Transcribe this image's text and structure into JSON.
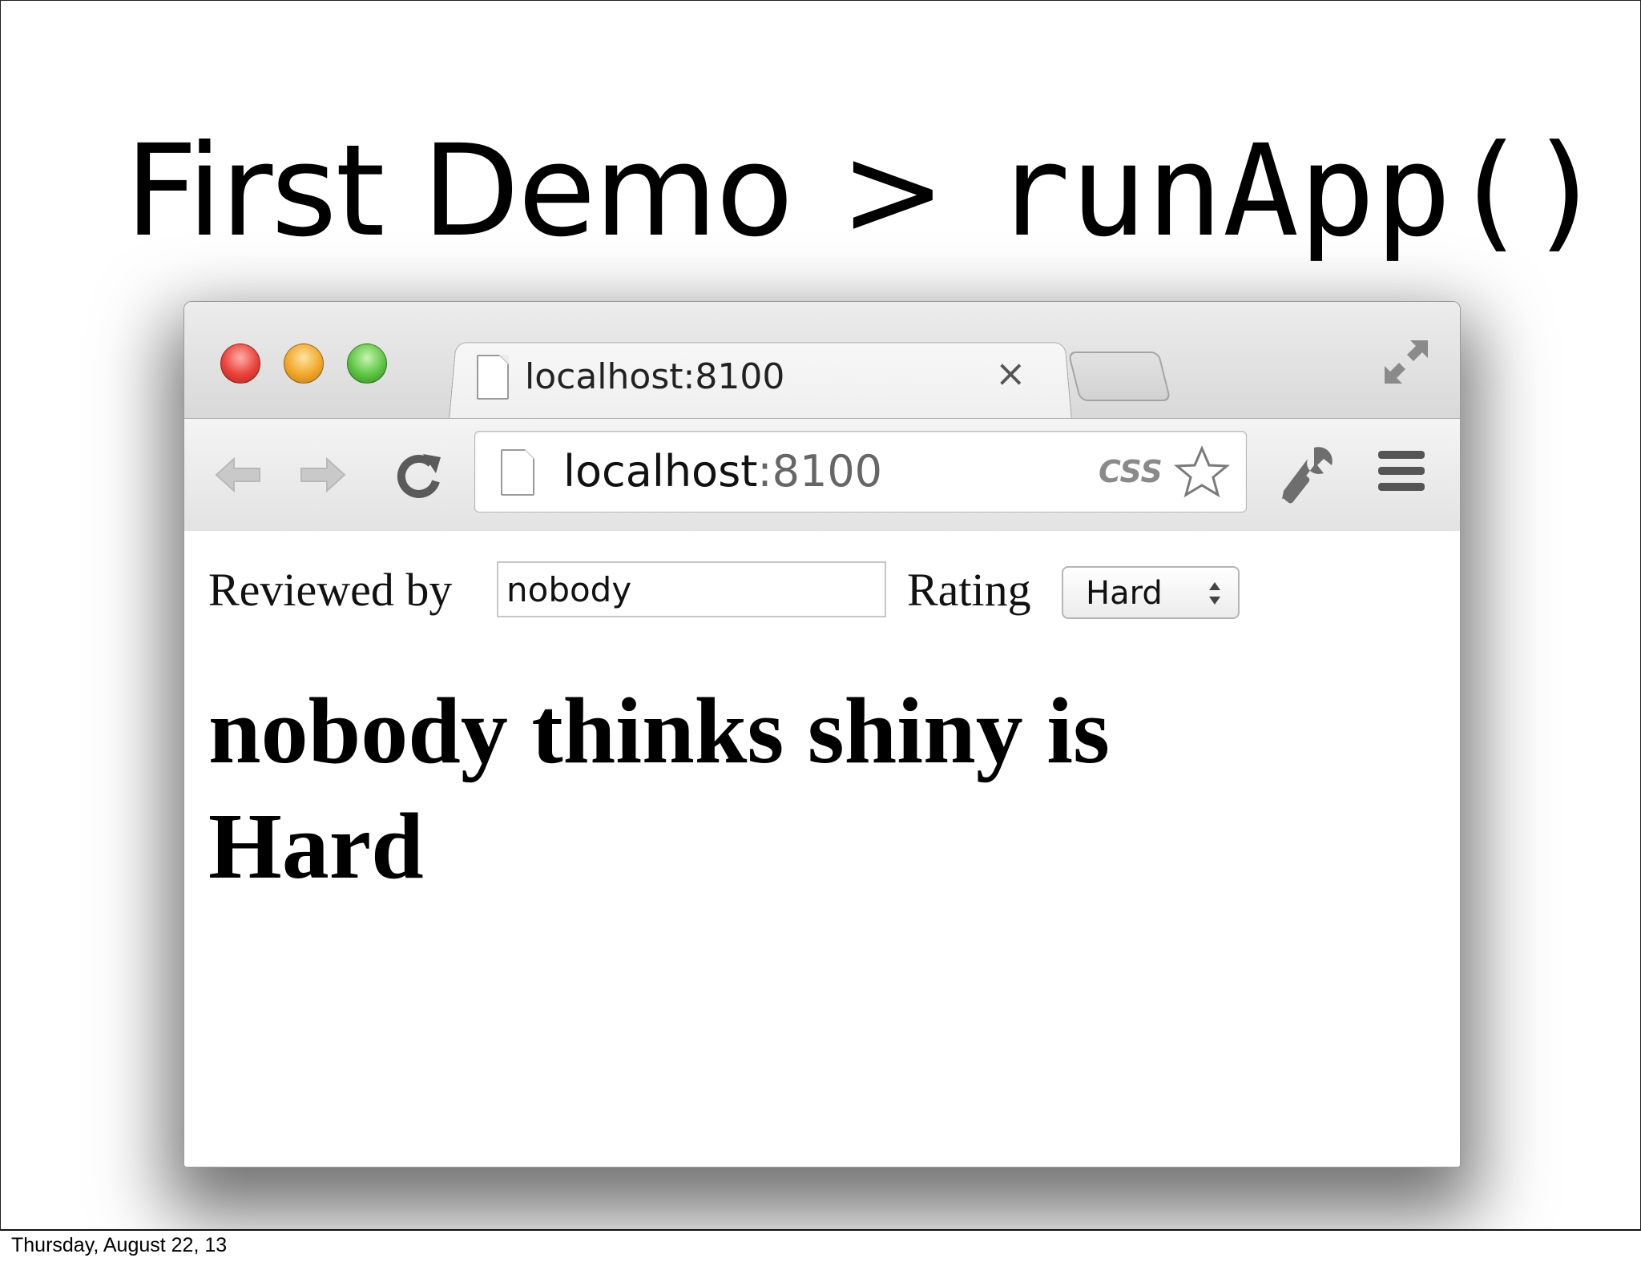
{
  "slide": {
    "title_main": "First Demo",
    "title_sep": ">",
    "title_code": "runApp()",
    "footer_date": "Thursday, August 22, 13"
  },
  "browser": {
    "tab": {
      "title": "localhost:8100",
      "close_glyph": "×"
    },
    "omnibox": {
      "host": "localhost",
      "port": ":8100",
      "badge": "CSS"
    },
    "icons": [
      "back-arrow-icon",
      "forward-arrow-icon",
      "reload-icon",
      "page-icon",
      "star-icon",
      "wrench-icon",
      "menu-icon",
      "fullscreen-icon"
    ]
  },
  "page": {
    "reviewed_label": "Reviewed by",
    "name_value": "nobody",
    "rating_label": "Rating",
    "rating_value": "Hard",
    "headline": "nobody thinks shiny is Hard"
  },
  "colors": {
    "close_red": "#e8413a",
    "minimize_yellow": "#f0a72b",
    "zoom_green": "#5ec444"
  }
}
